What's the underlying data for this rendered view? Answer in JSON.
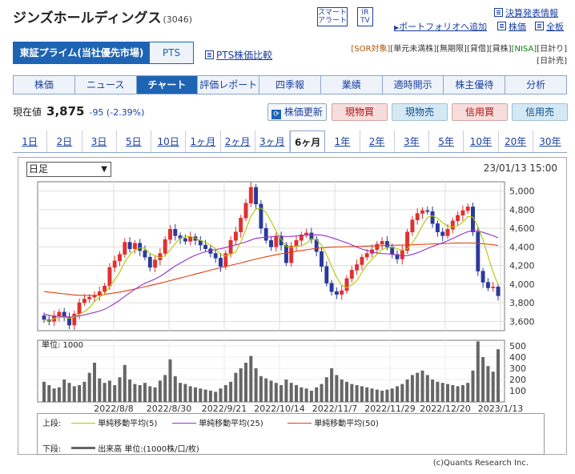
{
  "header": {
    "company": "ジンズホールディングス",
    "code": "(3046)",
    "smart_alert": [
      "スマート",
      "アラート"
    ],
    "ir_tv": [
      "IR",
      "TV"
    ],
    "portfolio_link": "ポートフォリオへ追加",
    "earnings_link": "決算発表情報",
    "stock_link": "株価",
    "full_link": "全板"
  },
  "market": {
    "active": "東証プライム(当社優先市場)",
    "pts": "PTS",
    "pts_compare": "PTS株価比較"
  },
  "badges": {
    "line1": [
      "[SOR対象]",
      "[単元未満株]",
      "[無期限]",
      "[貸借]",
      "[貸株]",
      "[NISA]",
      "[日計り]"
    ],
    "line2": "[日計売]"
  },
  "tabs": [
    "株価",
    "ニュース",
    "チャート",
    "評価レポート",
    "四季報",
    "業績",
    "適時開示",
    "株主優待",
    "分析"
  ],
  "active_tab": "チャート",
  "quote": {
    "label": "現在値",
    "price": "3,875",
    "change": "-95 (-2.39%)"
  },
  "buttons": {
    "update": "株価更新",
    "spot_buy": "現物買",
    "spot_sell": "現物売",
    "margin_buy": "信用買",
    "margin_sell": "信用売"
  },
  "ranges": [
    "1日",
    "2日",
    "3日",
    "5日",
    "10日",
    "1ヶ月",
    "2ヶ月",
    "3ヶ月",
    "6ヶ月",
    "1年",
    "2年",
    "3年",
    "5年",
    "10年",
    "20年",
    "30年"
  ],
  "active_range": "6ヶ月",
  "chart_controls": {
    "period_select": "日足",
    "timestamp": "23/01/13 15:00",
    "volume_unit": "単位: 1000"
  },
  "legend": {
    "upper": "上段:",
    "ma5": "単純移動平均(5)",
    "ma25": "単純移動平均(25)",
    "ma50": "単純移動平均(50)",
    "lower": "下段:",
    "volume": "出来高 単位:(1000株/口/枚)"
  },
  "copyright": "(c)Quants Research Inc.",
  "colors": {
    "up": "#e03030",
    "down": "#2a3a9a",
    "ma5": "#b0c800",
    "ma25": "#9a30c8",
    "ma50": "#e04010",
    "volume": "#666666",
    "accent": "#1e64b4"
  },
  "chart_data": {
    "type": "candlestick",
    "price_axis": {
      "ylim": [
        3500,
        5100
      ],
      "ticks": [
        "3,600",
        "3,800",
        "4,000",
        "4,200",
        "4,400",
        "4,600",
        "4,800",
        "5,000"
      ]
    },
    "volume_axis": {
      "ylim": [
        0,
        550
      ],
      "ticks": [
        "100",
        "200",
        "300",
        "400",
        "500"
      ]
    },
    "x_labels": [
      "2022/8/8",
      "2022/8/30",
      "2022/9/21",
      "2022/10/14",
      "2022/11/7",
      "2022/11/29",
      "2022/12/20",
      "2023/1/13"
    ],
    "close": [
      3620,
      3600,
      3660,
      3700,
      3640,
      3560,
      3680,
      3800,
      3840,
      3860,
      3880,
      3920,
      3980,
      4180,
      4250,
      4320,
      4450,
      4380,
      4440,
      4360,
      4290,
      4180,
      4260,
      4330,
      4480,
      4590,
      4520,
      4490,
      4460,
      4510,
      4470,
      4420,
      4380,
      4330,
      4280,
      4190,
      4330,
      4470,
      4560,
      4710,
      4870,
      5040,
      4860,
      4600,
      4470,
      4400,
      4510,
      4420,
      4230,
      4410,
      4470,
      4530,
      4550,
      4480,
      4350,
      4190,
      4010,
      3920,
      3890,
      3930,
      4060,
      4150,
      4210,
      4290,
      4330,
      4370,
      4430,
      4460,
      4400,
      4320,
      4270,
      4360,
      4560,
      4690,
      4760,
      4790,
      4780,
      4650,
      4560,
      4520,
      4590,
      4680,
      4740,
      4790,
      4830,
      4560,
      4140,
      4020,
      3960,
      3970,
      3875
    ],
    "ma5": [
      3620,
      3610,
      3627,
      3645,
      3644,
      3632,
      3648,
      3676,
      3704,
      3748,
      3812,
      3860,
      3896,
      3976,
      4046,
      4130,
      4236,
      4316,
      4368,
      4390,
      4384,
      4330,
      4306,
      4284,
      4308,
      4368,
      4436,
      4494,
      4508,
      4514,
      4490,
      4470,
      4448,
      4422,
      4378,
      4320,
      4302,
      4320,
      4346,
      4452,
      4588,
      4730,
      4808,
      4816,
      4768,
      4676,
      4568,
      4480,
      4406,
      4394,
      4408,
      4412,
      4438,
      4488,
      4476,
      4420,
      4316,
      4190,
      4072,
      3988,
      3962,
      3992,
      4038,
      4128,
      4208,
      4270,
      4320,
      4372,
      4392,
      4396,
      4380,
      4366,
      4382,
      4440,
      4528,
      4632,
      4716,
      4734,
      4708,
      4660,
      4620,
      4616,
      4628,
      4666,
      4726,
      4720,
      4618,
      4478,
      4302,
      4130,
      3993
    ],
    "ma25": [
      3680,
      3665,
      3656,
      3654,
      3652,
      3645,
      3648,
      3658,
      3670,
      3683,
      3696,
      3711,
      3730,
      3760,
      3792,
      3827,
      3869,
      3906,
      3945,
      3979,
      4009,
      4031,
      4056,
      4084,
      4119,
      4158,
      4194,
      4226,
      4256,
      4286,
      4311,
      4331,
      4347,
      4360,
      4372,
      4380,
      4393,
      4408,
      4422,
      4437,
      4454,
      4474,
      4492,
      4500,
      4505,
      4509,
      4516,
      4518,
      4511,
      4513,
      4517,
      4523,
      4527,
      4528,
      4530,
      4527,
      4516,
      4500,
      4482,
      4463,
      4444,
      4421,
      4396,
      4377,
      4362,
      4346,
      4334,
      4328,
      4326,
      4321,
      4311,
      4303,
      4307,
      4320,
      4337,
      4359,
      4383,
      4405,
      4425,
      4444,
      4466,
      4491,
      4515,
      4542,
      4563,
      4574,
      4570,
      4556,
      4538,
      4520,
      4498
    ],
    "ma50": [
      3920,
      3914,
      3908,
      3902,
      3896,
      3890,
      3884,
      3880,
      3878,
      3878,
      3880,
      3884,
      3890,
      3898,
      3906,
      3915,
      3925,
      3936,
      3948,
      3960,
      3972,
      3984,
      3997,
      4010,
      4024,
      4038,
      4052,
      4066,
      4080,
      4094,
      4108,
      4122,
      4136,
      4150,
      4163,
      4176,
      4189,
      4202,
      4215,
      4228,
      4242,
      4256,
      4270,
      4282,
      4294,
      4305,
      4316,
      4326,
      4335,
      4344,
      4353,
      4361,
      4369,
      4377,
      4384,
      4390,
      4394,
      4397,
      4399,
      4401,
      4403,
      4405,
      4406,
      4407,
      4409,
      4411,
      4413,
      4415,
      4417,
      4418,
      4419,
      4420,
      4421,
      4423,
      4425,
      4427,
      4429,
      4432,
      4434,
      4436,
      4438,
      4440,
      4441,
      4442,
      4442,
      4441,
      4438,
      4434,
      4429,
      4423,
      4415
    ],
    "volume": [
      180,
      150,
      120,
      130,
      200,
      170,
      140,
      150,
      180,
      260,
      350,
      210,
      170,
      190,
      150,
      220,
      330,
      200,
      160,
      150,
      170,
      140,
      130,
      190,
      240,
      380,
      230,
      170,
      160,
      140,
      130,
      120,
      110,
      100,
      90,
      120,
      150,
      180,
      260,
      300,
      350,
      410,
      300,
      230,
      210,
      190,
      170,
      150,
      200,
      170,
      150,
      130,
      120,
      100,
      130,
      160,
      220,
      300,
      240,
      200,
      180,
      160,
      150,
      140,
      130,
      120,
      110,
      100,
      110,
      120,
      140,
      160,
      200,
      240,
      260,
      280,
      240,
      200,
      180,
      170,
      160,
      150,
      140,
      150,
      170,
      280,
      540,
      400,
      320,
      270,
      470
    ]
  }
}
